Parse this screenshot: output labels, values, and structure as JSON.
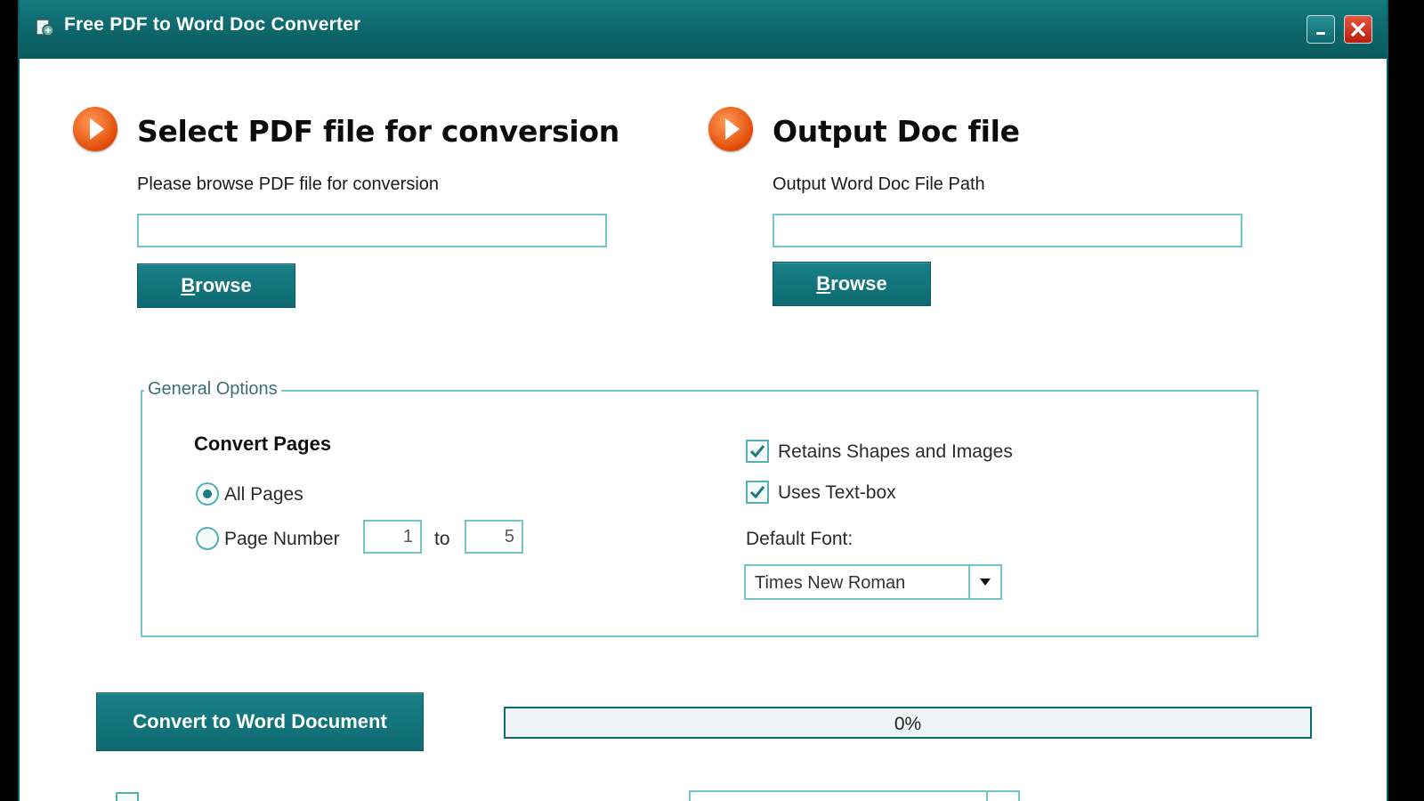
{
  "window": {
    "title": "Free PDF to Word Doc Converter",
    "minimize_label": "_",
    "close_label": "✕"
  },
  "input_section": {
    "title": "Select PDF file for conversion",
    "caption": "Please browse PDF file for conversion",
    "path_value": "",
    "browse_label": "rowse",
    "browse_hotkey": "B"
  },
  "output_section": {
    "title": "Output Doc file",
    "caption": "Output Word Doc File Path",
    "path_value": "",
    "browse_label": "rowse",
    "browse_hotkey": "B"
  },
  "general_options": {
    "legend": "General Options",
    "convert_pages_label": "Convert Pages",
    "all_pages_label": "All Pages",
    "page_number_label": "Page Number",
    "page_from": "1",
    "to_label": "to",
    "page_to": "5",
    "all_pages_selected": true,
    "retains_shapes_label": "Retains Shapes and Images",
    "retains_shapes_checked": true,
    "uses_textbox_label": "Uses Text-box",
    "uses_textbox_checked": true,
    "default_font_label": "Default Font:",
    "default_font_value": "Times New Roman"
  },
  "convert": {
    "button_label": "Convert to Word Document",
    "progress_text": "0%",
    "progress_fraction": 0
  },
  "colors": {
    "titlebar": "#0c6468",
    "accent_teal": "#1a8088",
    "border_teal": "#74c6c9",
    "section_icon": "#e24c08",
    "link": "#1b35d6"
  }
}
